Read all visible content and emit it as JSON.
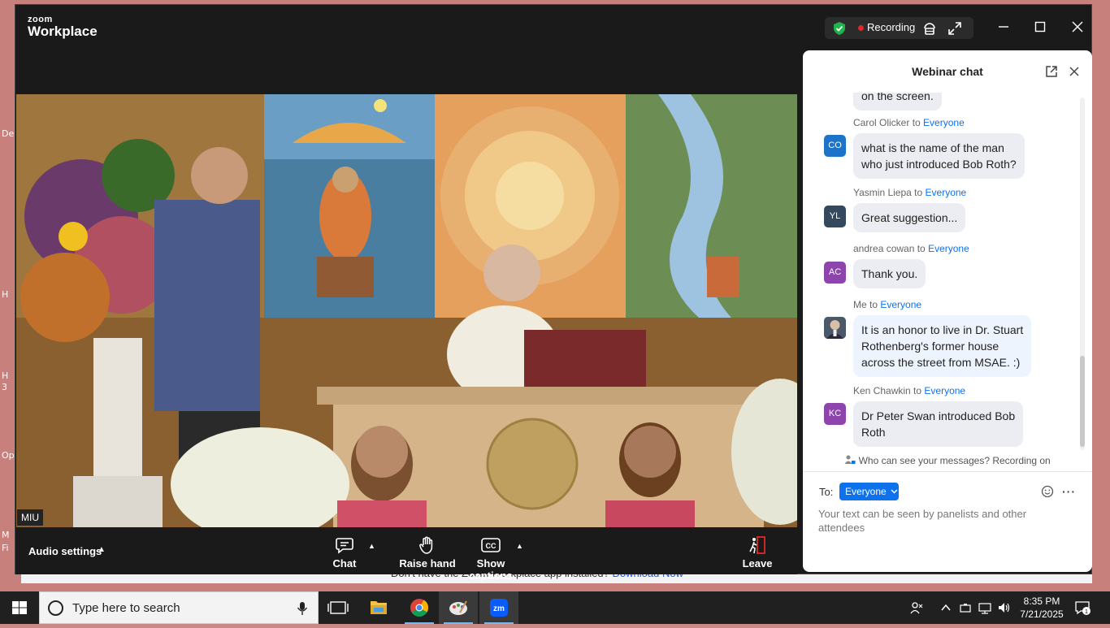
{
  "desktop": {
    "side_texts": [
      "De",
      "H",
      "H",
      "3",
      "Op",
      "M",
      "Fi"
    ]
  },
  "browser": {
    "banner_text": "Don't have the Zoom Workplace app installed?",
    "banner_link": "Download Now"
  },
  "app": {
    "logo_small": "zoom",
    "logo_big": "Workplace",
    "recording_label": "Recording"
  },
  "video": {
    "source_label": "MIU"
  },
  "toolbar": {
    "audio_settings": "Audio settings",
    "chat": "Chat",
    "raise_hand": "Raise hand",
    "show_captions": "Show captions",
    "leave": "Leave"
  },
  "chat": {
    "title": "Webinar chat",
    "partial_message": "on the screen.",
    "messages": [
      {
        "sender": "Carol Olicker",
        "to_word": " to ",
        "recipient": "Everyone",
        "initials": "CO",
        "avatar_color": "#1d73c7",
        "text_lines": [
          "what is the name of the man",
          "who just introduced Bob Roth?"
        ]
      },
      {
        "sender": "Yasmin Liepa",
        "to_word": " to ",
        "recipient": "Everyone",
        "initials": "YL",
        "avatar_color": "#34495e",
        "text_lines": [
          "Great suggestion..."
        ]
      },
      {
        "sender": "andrea cowan",
        "to_word": " to ",
        "recipient": "Everyone",
        "initials": "AC",
        "avatar_color": "#8e44ad",
        "text_lines": [
          "Thank you."
        ]
      },
      {
        "sender": "Me",
        "to_word": " to ",
        "recipient": "Everyone",
        "initials": "",
        "avatar_color": "#5a6a7a",
        "text_lines": [
          "It is an honor to live in Dr. Stuart",
          "Rothenberg's former house",
          "across the street from MSAE. :)"
        ]
      },
      {
        "sender": "Ken Chawkin",
        "to_word": " to ",
        "recipient": "Everyone",
        "initials": "KC",
        "avatar_color": "#8e44ad",
        "text_lines": [
          "Dr Peter Swan introduced Bob",
          "Roth"
        ]
      }
    ],
    "visibility_notice": "Who can see your messages? Recording on",
    "to_label": "To:",
    "recipient_select": "Everyone",
    "input_placeholder": "Your text can be seen by panelists and other attendees",
    "more_label": "···"
  },
  "taskbar": {
    "search_placeholder": "Type here to search",
    "time": "8:35 PM",
    "date": "7/21/2025",
    "notification_count": "1"
  }
}
